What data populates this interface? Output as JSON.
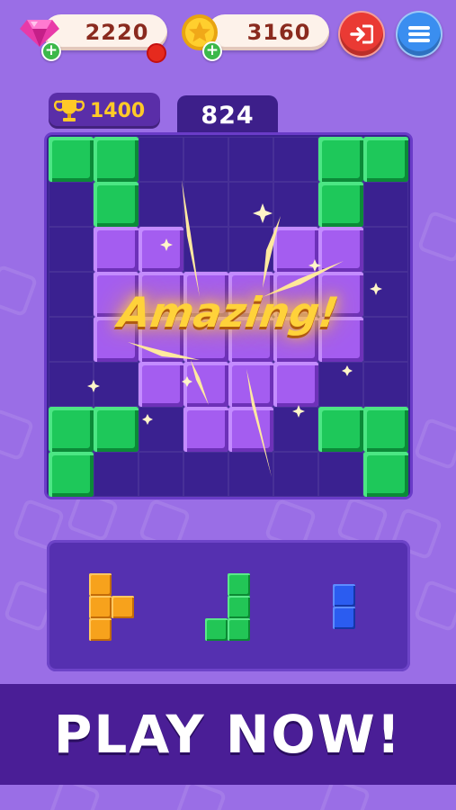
{
  "header": {
    "gems": "2220",
    "coins": "3160",
    "gem_icon": "pink-gem-icon",
    "coin_icon": "gold-star-coin-icon",
    "exit_icon": "exit-door-icon",
    "menu_icon": "hamburger-menu-icon"
  },
  "score": {
    "best": "1400",
    "current": "824",
    "best_icon": "trophy-icon"
  },
  "board": {
    "size": 8,
    "green_cells": [
      [
        0,
        0
      ],
      [
        0,
        1
      ],
      [
        1,
        1
      ],
      [
        0,
        6
      ],
      [
        0,
        7
      ],
      [
        1,
        6
      ],
      [
        6,
        0
      ],
      [
        6,
        1
      ],
      [
        7,
        0
      ],
      [
        6,
        6
      ],
      [
        6,
        7
      ],
      [
        7,
        7
      ]
    ],
    "purple_cells": [
      [
        2,
        1
      ],
      [
        2,
        2
      ],
      [
        2,
        5
      ],
      [
        2,
        6
      ],
      [
        3,
        1
      ],
      [
        3,
        2
      ],
      [
        3,
        3
      ],
      [
        3,
        4
      ],
      [
        3,
        5
      ],
      [
        3,
        6
      ],
      [
        4,
        1
      ],
      [
        4,
        2
      ],
      [
        4,
        3
      ],
      [
        4,
        4
      ],
      [
        4,
        5
      ],
      [
        4,
        6
      ],
      [
        5,
        2
      ],
      [
        5,
        3
      ],
      [
        5,
        4
      ],
      [
        5,
        5
      ],
      [
        6,
        3
      ],
      [
        6,
        4
      ]
    ],
    "colors": {
      "green": "#1ec85a",
      "purple": "#a45df0",
      "board": "#3a2190"
    }
  },
  "feedback": {
    "message": "Amazing!"
  },
  "tray": {
    "pieces": [
      {
        "color": "orange",
        "hex": "#f7a21c",
        "cells": [
          [
            0,
            0
          ],
          [
            1,
            0
          ],
          [
            1,
            1
          ],
          [
            2,
            0
          ]
        ]
      },
      {
        "color": "green",
        "hex": "#22c656",
        "cells": [
          [
            0,
            1
          ],
          [
            1,
            1
          ],
          [
            2,
            0
          ],
          [
            2,
            1
          ]
        ]
      },
      {
        "color": "blue",
        "hex": "#2b5cf0",
        "cells": [
          [
            0,
            0
          ],
          [
            1,
            0
          ]
        ]
      }
    ]
  },
  "cta": {
    "label": "PLAY NOW!"
  }
}
